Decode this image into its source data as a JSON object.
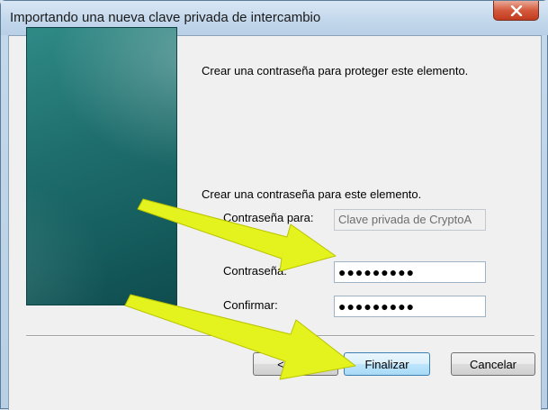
{
  "window": {
    "title": "Importando una nueva clave privada de intercambio"
  },
  "main": {
    "instruction": "Crear una contraseña para proteger este elemento.",
    "password_section_label": "Crear una contraseña para este elemento.",
    "password_for_label": "Contraseña para:",
    "password_for_value": "Clave privada de CryptoA",
    "password_label": "Contraseña:",
    "password_value": "●●●●●●●●●",
    "confirm_label": "Confirmar:",
    "confirm_value": "●●●●●●●●●"
  },
  "buttons": {
    "back": "< Atrás",
    "finish": "Finalizar",
    "cancel": "Cancelar"
  },
  "colors": {
    "annotation_arrow": "#e4f21e",
    "side_panel": "#1f6f6e",
    "close_button": "#c94a2c"
  },
  "icons": {
    "close": "close-icon",
    "arrows": "annotation-arrow"
  }
}
